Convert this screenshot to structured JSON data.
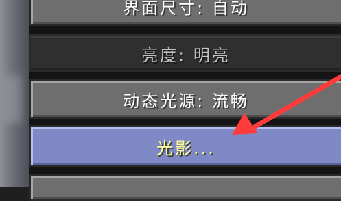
{
  "menu": {
    "buttons": [
      {
        "label": "界面尺寸: 自动",
        "state": "normal"
      },
      {
        "label": "亮度: 明亮",
        "state": "disabled"
      },
      {
        "label": "动态光源: 流畅",
        "state": "normal"
      },
      {
        "label": "光影...",
        "state": "hover"
      },
      {
        "label": "",
        "state": "normal"
      }
    ]
  },
  "annotation": {
    "arrow_color": "#ff3b3b"
  }
}
